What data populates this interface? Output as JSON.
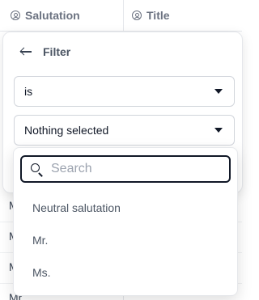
{
  "table": {
    "columns": [
      {
        "label": "Salutation",
        "icon": "person-circle-icon"
      },
      {
        "label": "Title",
        "icon": "person-circle-icon"
      }
    ],
    "visible_rows": [
      "M",
      "M",
      "M",
      "Mr."
    ]
  },
  "filter": {
    "title": "Filter",
    "operator": "is",
    "value": "Nothing selected",
    "search_placeholder": "Search",
    "options": [
      "Neutral salutation",
      "Mr.",
      "Ms."
    ]
  }
}
